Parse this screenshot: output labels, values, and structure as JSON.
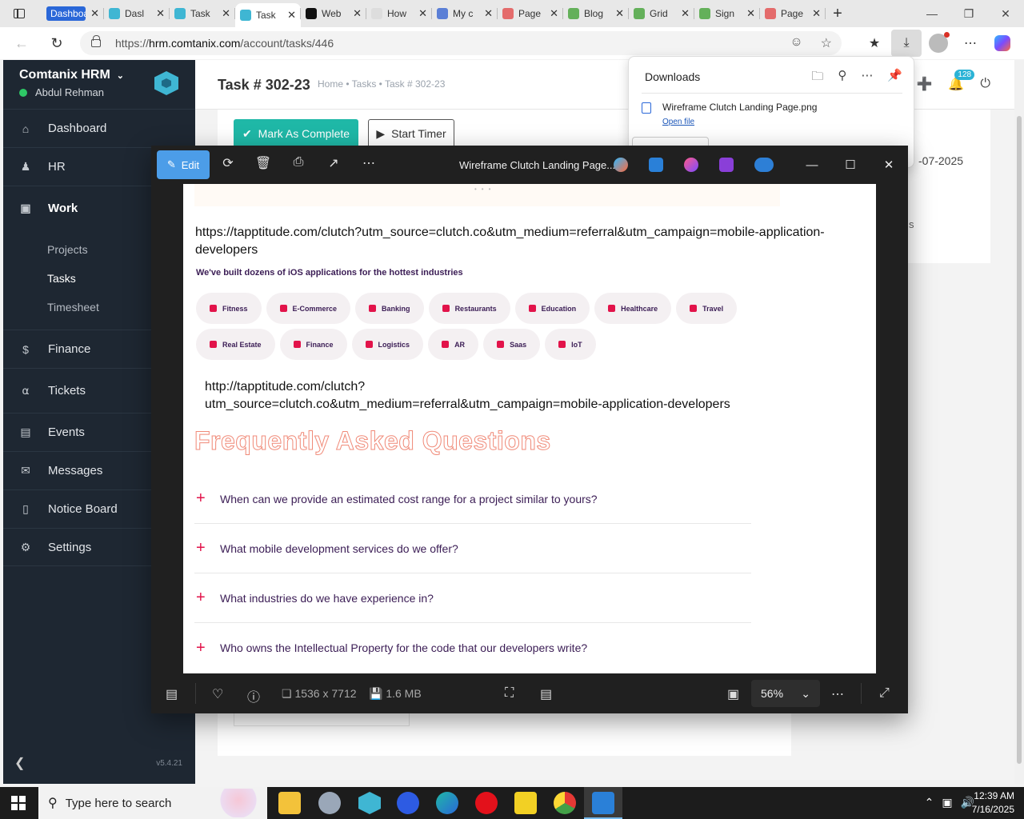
{
  "browser": {
    "tabs": [
      {
        "label": "Dashboard",
        "color": "#2a67d8"
      },
      {
        "label": "Dasl",
        "color": "#3fb6d3"
      },
      {
        "label": "Task",
        "color": "#3fb6d3"
      },
      {
        "label": "Task",
        "color": "#3fb6d3"
      },
      {
        "label": "Web",
        "color": "#111111"
      },
      {
        "label": "How",
        "color": "#dddddd"
      },
      {
        "label": "My c",
        "color": "#5b7fd6"
      },
      {
        "label": "Page",
        "color": "#e46b6b"
      },
      {
        "label": "Blog",
        "color": "#64b05a"
      },
      {
        "label": "Grid",
        "color": "#64b05a"
      },
      {
        "label": "Sign",
        "color": "#64b05a"
      },
      {
        "label": "Page",
        "color": "#e46b6b"
      }
    ],
    "url_prefix": "https://",
    "url_host": "hrm.comtanix.com",
    "url_path": "/account/tasks/446"
  },
  "downloads": {
    "title": "Downloads",
    "file_name": "Wireframe Clutch Landing Page.png",
    "open_label": "Open file"
  },
  "sidebar": {
    "brand": "Comtanix HRM",
    "user": "Abdul Rehman",
    "items": {
      "dashboard": "Dashboard",
      "hr": "HR",
      "work": "Work",
      "projects": "Projects",
      "tasks": "Tasks",
      "timesheet": "Timesheet",
      "finance": "Finance",
      "tickets": "Tickets",
      "events": "Events",
      "messages": "Messages",
      "notice_board": "Notice Board",
      "settings": "Settings"
    },
    "version": "v5.4.21"
  },
  "header": {
    "title": "Task # 302-23",
    "breadcrumb": "Home • Tasks • Task # 302-23",
    "notification_count": "128"
  },
  "task": {
    "complete_label": "Mark As Complete",
    "timer_label": "Start Timer",
    "date_fragment": "-07-2025",
    "side_fragment": "s"
  },
  "viewer": {
    "edit_label": "Edit",
    "title": "Wireframe Clutch Landing Page...",
    "dimensions": "1536 x 7712",
    "file_size": "1.6 MB",
    "zoom": "56%"
  },
  "image": {
    "url1": "https://tapptitude.com/clutch?utm_source=clutch.co&utm_medium=referral&utm_campaign=mobile-application-developers",
    "headline": "We've built dozens of iOS applications for the hottest industries",
    "chips_row1": [
      "Fitness",
      "E-Commerce",
      "Banking",
      "Restaurants",
      "Education",
      "Healthcare",
      "Travel"
    ],
    "chips_row2": [
      "Real Estate",
      "Finance",
      "Logistics",
      "AR",
      "Saas",
      "IoT"
    ],
    "url2": "http://tapptitude.com/clutch?utm_source=clutch.co&utm_medium=referral&utm_campaign=mobile-application-developers",
    "faq_title": "Frequently Asked Questions",
    "faqs": [
      "When can we provide an estimated cost range for a project similar to yours?",
      "What mobile development services do we offer?",
      "What industries do we have experience in?",
      "Who owns the Intellectual Property for the code that our developers write?"
    ],
    "accent": "#e2134a"
  },
  "taskbar": {
    "search_placeholder": "Type here to search",
    "time": "12:39 AM",
    "date": "7/16/2025"
  }
}
